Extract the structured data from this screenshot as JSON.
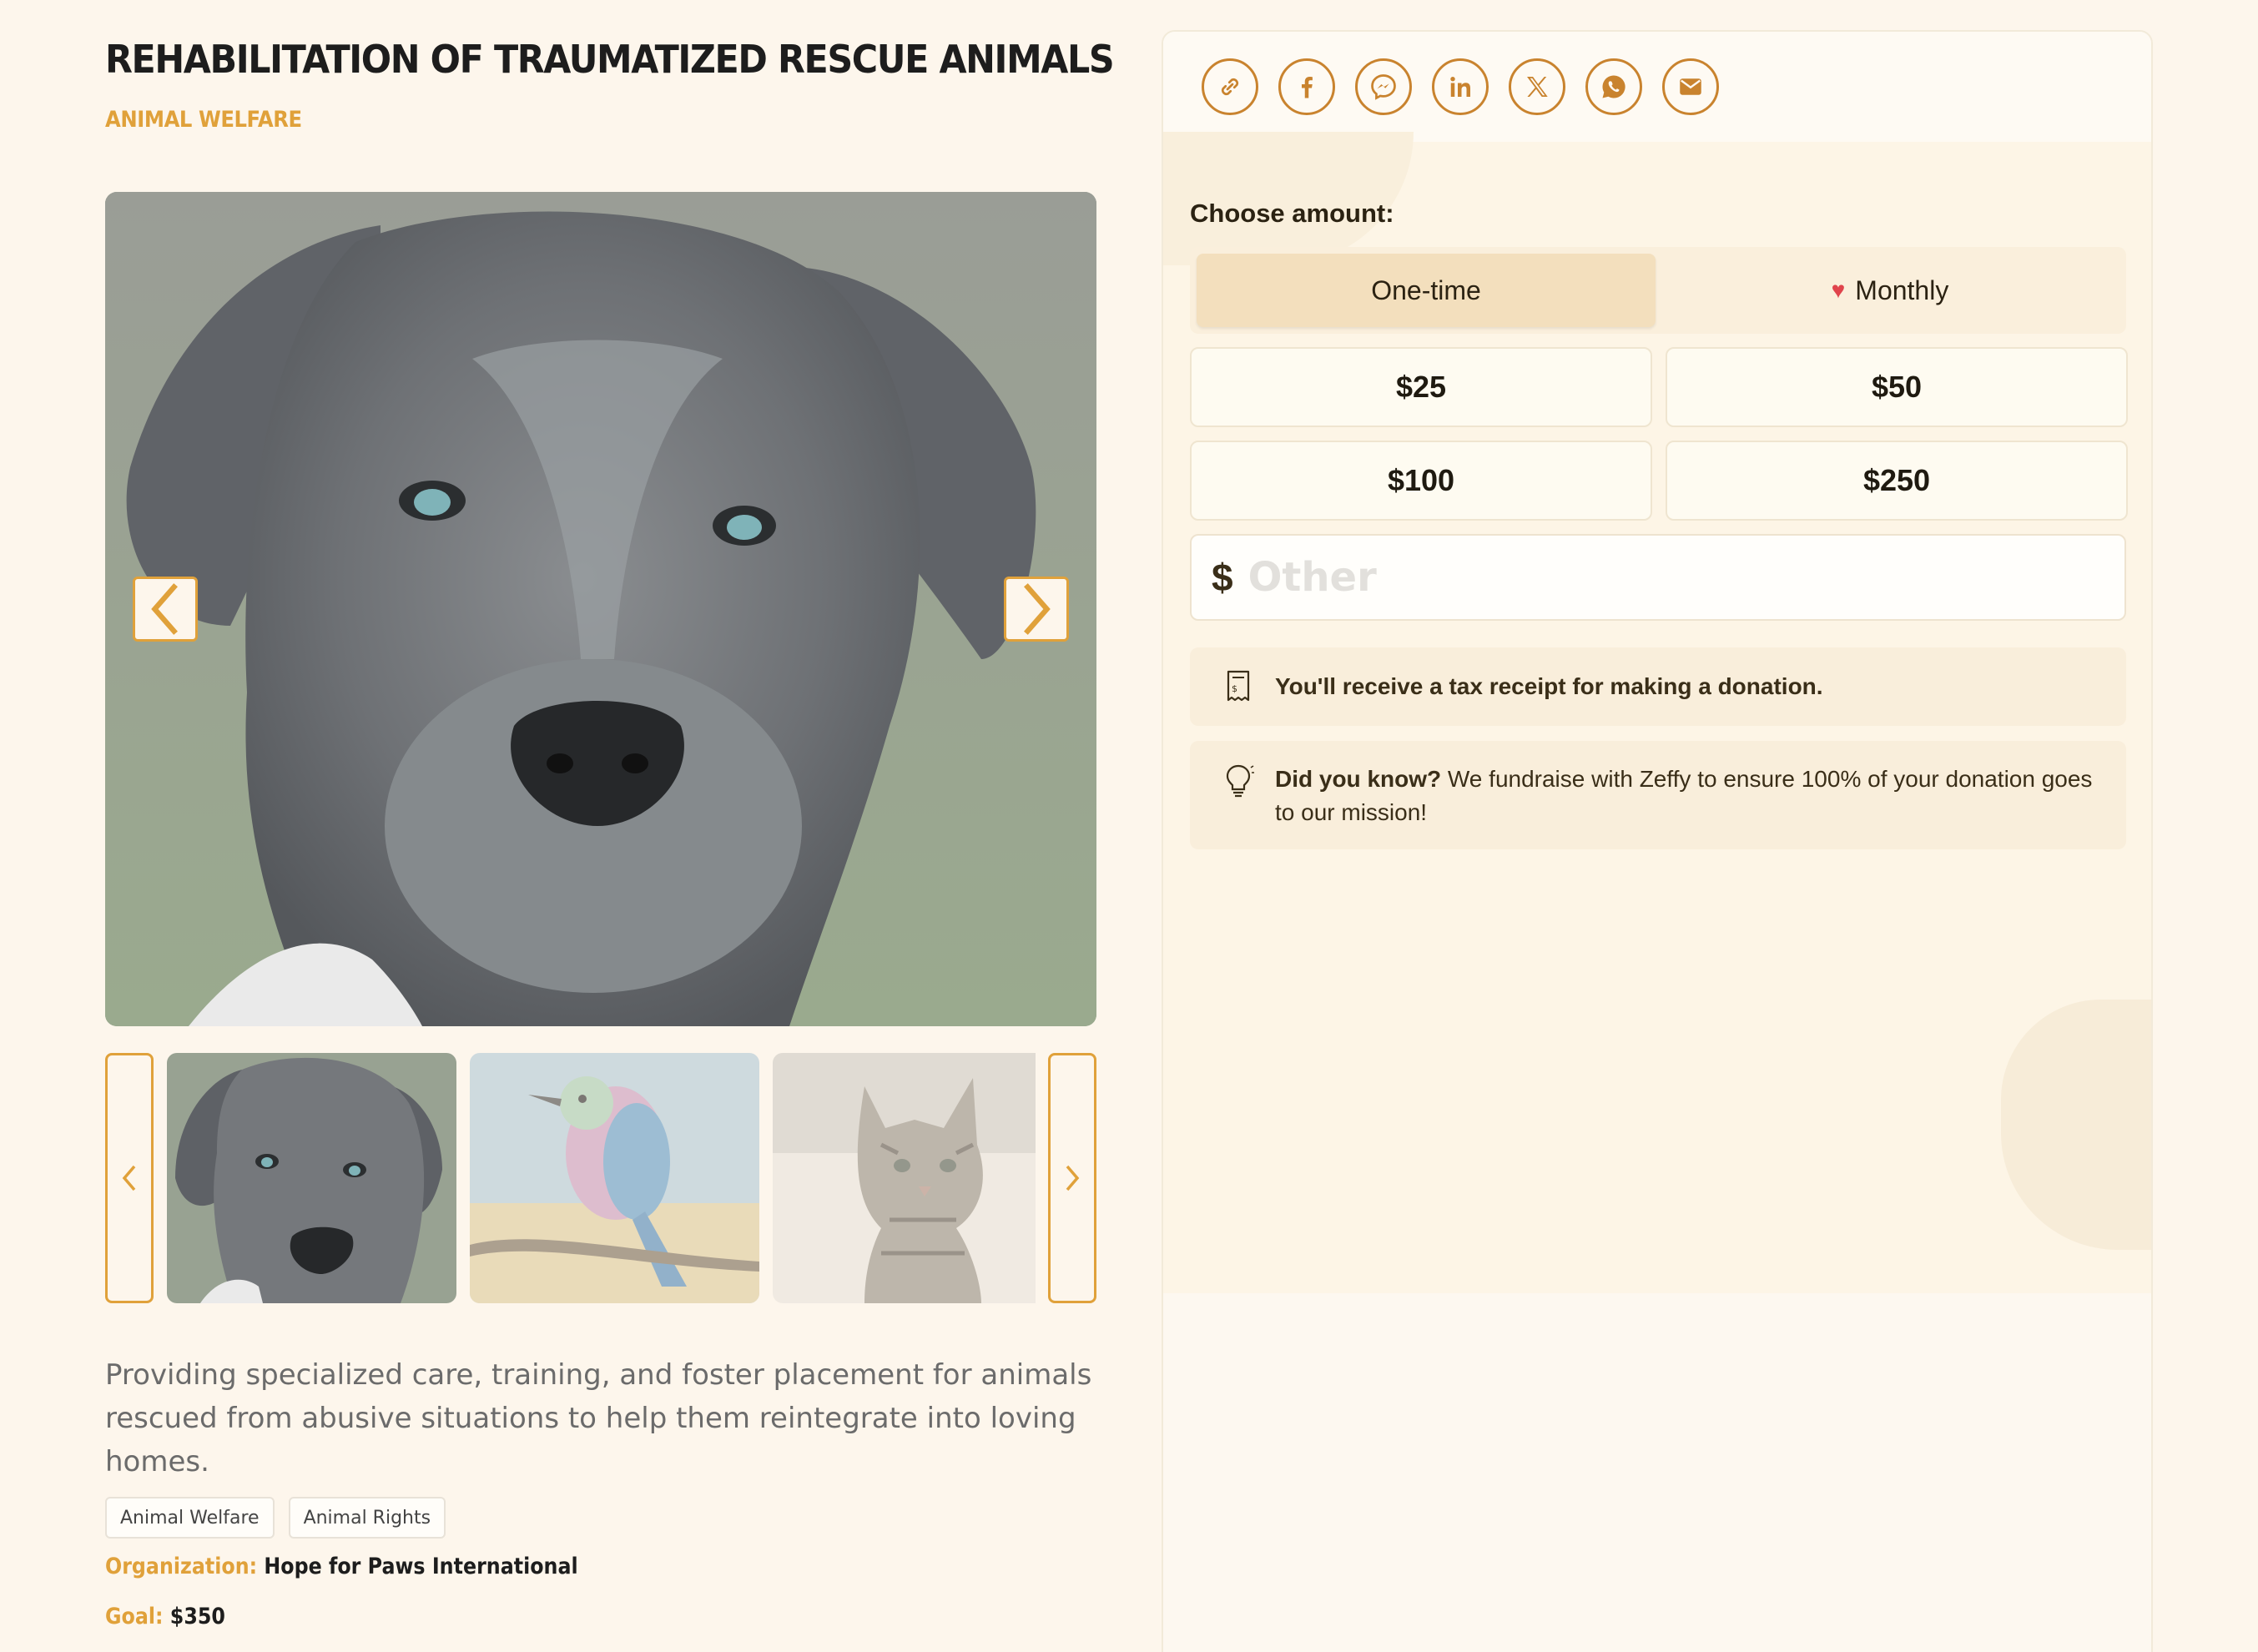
{
  "campaign": {
    "title": "REHABILITATION OF TRAUMATIZED RESCUE ANIMALS",
    "category": "ANIMAL WELFARE",
    "description": "Providing specialized care, training, and foster placement for animals rescued from abusive situations to help them reintegrate into loving homes.",
    "tags": [
      "Animal Welfare",
      "Animal Rights"
    ],
    "organization_label": "Organization:",
    "organization": "Hope for Paws International",
    "goal_label": "Goal:",
    "goal": "$350"
  },
  "gallery": {
    "main_image": "grey-dog-portrait",
    "thumbnails": [
      "grey-dog-portrait",
      "lilac-breasted-roller-bird",
      "tabby-kitten"
    ],
    "active_index": 0
  },
  "share": {
    "icons": [
      "link-icon",
      "facebook-icon",
      "messenger-icon",
      "linkedin-icon",
      "x-icon",
      "whatsapp-icon",
      "email-icon"
    ],
    "accent": "#c9832e"
  },
  "donation": {
    "choose_label": "Choose amount:",
    "frequency": {
      "one_time": "One-time",
      "monthly": "Monthly",
      "selected": "One-time"
    },
    "amounts": [
      "$25",
      "$50",
      "$100",
      "$250"
    ],
    "other": {
      "currency": "$",
      "placeholder": "Other"
    },
    "receipt_note": "You'll receive a tax receipt for making a donation.",
    "did_you_know_label": "Did you know?",
    "did_you_know_text": " We fundraise with Zeffy to ensure 100% of your donation goes to our mission!"
  },
  "colors": {
    "background": "#fdf6ec",
    "accent": "#e0a13a",
    "heart": "#e0444c",
    "selected_tab": "#f3dfbd"
  }
}
